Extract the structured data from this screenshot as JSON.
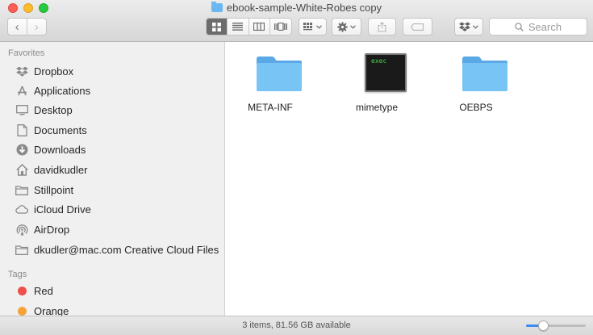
{
  "window": {
    "title": "ebook-sample-White-Robes copy"
  },
  "toolbar": {
    "back_glyph": "‹",
    "forward_glyph": "›",
    "view_modes": [
      "icon-view",
      "list-view",
      "column-view",
      "cover-flow-view"
    ],
    "active_view": "icon-view",
    "search_placeholder": "Search"
  },
  "sidebar": {
    "favorites_title": "Favorites",
    "favorites": [
      {
        "label": "Dropbox",
        "icon": "dropbox-icon"
      },
      {
        "label": "Applications",
        "icon": "applications-icon"
      },
      {
        "label": "Desktop",
        "icon": "desktop-icon"
      },
      {
        "label": "Documents",
        "icon": "documents-icon"
      },
      {
        "label": "Downloads",
        "icon": "downloads-icon"
      },
      {
        "label": "davidkudler",
        "icon": "home-icon"
      },
      {
        "label": "Stillpoint",
        "icon": "folder-icon"
      },
      {
        "label": "iCloud Drive",
        "icon": "cloud-icon"
      },
      {
        "label": "AirDrop",
        "icon": "airdrop-icon"
      },
      {
        "label": "dkudler@mac.com Creative Cloud Files",
        "icon": "folder-icon"
      }
    ],
    "tags_title": "Tags",
    "tags": [
      {
        "label": "Red",
        "color": "#ef4f4a"
      },
      {
        "label": "Orange",
        "color": "#f6a23a"
      }
    ]
  },
  "content": {
    "items": [
      {
        "name": "META-INF",
        "kind": "folder"
      },
      {
        "name": "mimetype",
        "kind": "exec",
        "badge": "exec"
      },
      {
        "name": "OEBPS",
        "kind": "folder"
      }
    ]
  },
  "status": {
    "text": "3 items, 81.56 GB available",
    "icon_size_fraction": 0.25
  },
  "colors": {
    "folder": "#6bb8f0",
    "accent": "#3b8cf6"
  }
}
